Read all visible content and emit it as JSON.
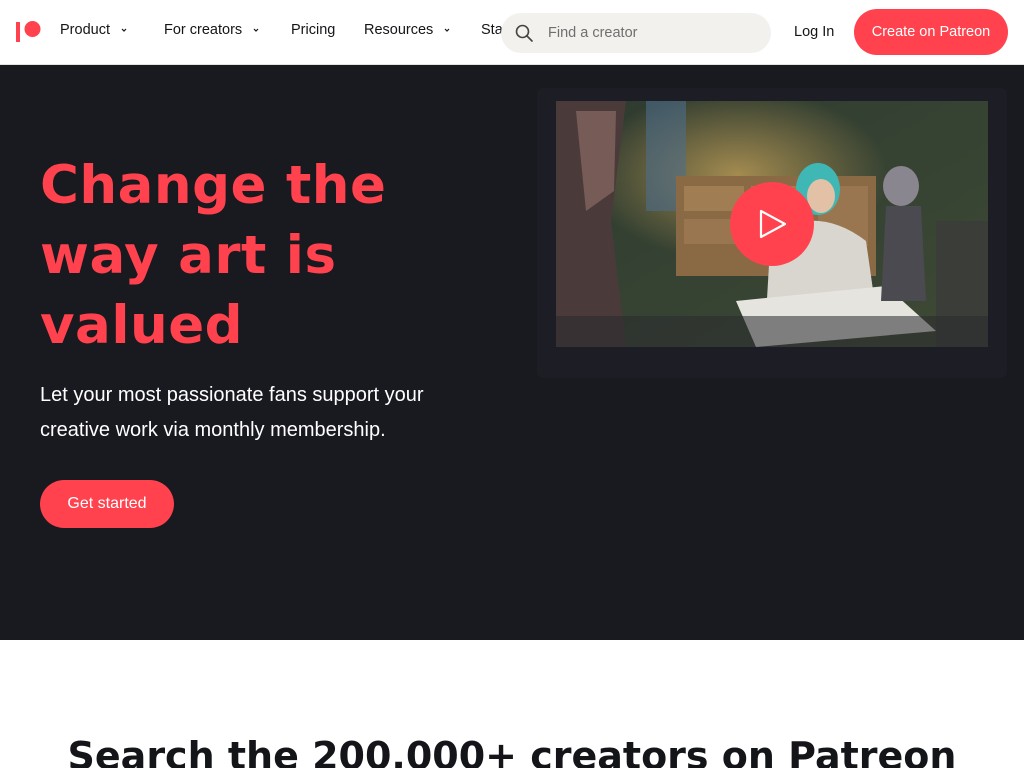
{
  "brand": {
    "accent": "#ff424d",
    "dark_bg": "#191920",
    "logo_icon": "patreon-logo-icon"
  },
  "nav": {
    "items": [
      {
        "label": "Product",
        "has_dropdown": true
      },
      {
        "label": "For creators",
        "has_dropdown": true
      },
      {
        "label": "Pricing",
        "has_dropdown": false
      },
      {
        "label": "Resources",
        "has_dropdown": true
      },
      {
        "label": "Sta",
        "has_dropdown": false
      }
    ],
    "search": {
      "placeholder": "Find a creator",
      "icon": "search-icon"
    },
    "login_label": "Log In",
    "cta_label": "Create on Patreon"
  },
  "hero": {
    "headline_lines": [
      "Change the",
      "way art is",
      "valued"
    ],
    "subtitle": "Let your most passionate fans support your creative work via monthly membership.",
    "cta_label": "Get started",
    "video": {
      "play_icon": "play-icon"
    }
  },
  "search_section": {
    "title": "Search the 200,000+ creators on Patreon"
  }
}
